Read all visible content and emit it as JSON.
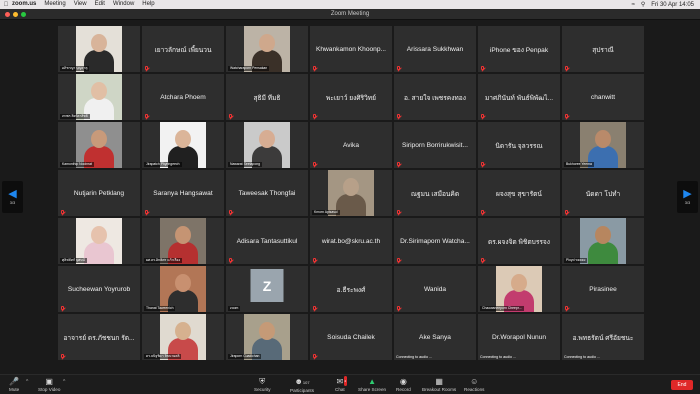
{
  "menubar": {
    "app": "zoom.us",
    "items": [
      "Meeting",
      "View",
      "Edit",
      "Window",
      "Help"
    ],
    "clock": "Fri 30 Apr 14:05"
  },
  "window": {
    "title": "Zoom Meeting"
  },
  "paging": {
    "left": "3/3",
    "right": "3/3"
  },
  "tiles": [
    {
      "label": "อภิชาญา บุญธาตุ",
      "video": true,
      "skin": "#d8b49a",
      "shirt": "#2a2a2a",
      "bg": "#e4e0d8"
    },
    {
      "name": "เยาวลักษณ์ เพี้ยนวน"
    },
    {
      "label": "Watcharaporn Pensakan",
      "video": true,
      "skin": "#cfa88c",
      "shirt": "#3a3028",
      "bg": "#bcb3a6"
    },
    {
      "name": "Khwankamon Khoonp..."
    },
    {
      "name": "Arissara Sukkhwan"
    },
    {
      "name": "iPhone ของ Penpak"
    },
    {
      "name": "สุปราณี"
    },
    {
      "label": "ภทพร สิงห์ลาสิทธิ์",
      "video": true,
      "skin": "#e1bfa5",
      "shirt": "#f0f0f0",
      "bg": "#cfd6c6"
    },
    {
      "name": "Atchara Phoem"
    },
    {
      "name": "สุธิมี ทีมธิ"
    },
    {
      "name": "พะเยาว์ ยงศิริวิทย์"
    },
    {
      "name": "อ. สายใจ เพชรคงทอง"
    },
    {
      "name": "มาศภินันท์ พันธ์พิพัฒไ..."
    },
    {
      "name": "chanwitt"
    },
    {
      "label": "Kamonthip Nooinrat",
      "video": true,
      "skin": "#c89a7a",
      "shirt": "#c03030",
      "bg": "#8f8f8f"
    },
    {
      "label": "Jirapatch Phyringeech",
      "video": true,
      "skin": "#dbb599",
      "shirt": "#202020",
      "bg": "#f2f2f2"
    },
    {
      "label": "Nawarat Seetapong",
      "video": true,
      "skin": "#d7ad93",
      "shirt": "#3c3b3b",
      "bg": "#cacaca"
    },
    {
      "name": "Avika"
    },
    {
      "name": "Siriporn Borrirukwisit..."
    },
    {
      "name": "นิดารัน จุลวรรณ"
    },
    {
      "label": "Bukhoree Yeema",
      "video": true,
      "skin": "#b98a6a",
      "shirt": "#3c6fb0",
      "bg": "#8a8070"
    },
    {
      "name": "Nutjarin Petklang"
    },
    {
      "name": "Saranya  Hangsawat"
    },
    {
      "name": "Taweesak Thongfai"
    },
    {
      "label": "Kmorn Apisasul",
      "video": true,
      "skin": "#b7a089",
      "shirt": "#6a5a4a",
      "bg": "#a49683"
    },
    {
      "name": "ณฐมน เสมือนคิด"
    },
    {
      "name": "ผจงสุข สุขารัตน์"
    },
    {
      "name": "นัดดา  โปทำ"
    },
    {
      "label": "ศุลิฟลัทก์ บุศนน์",
      "video": true,
      "skin": "#e6c2ad",
      "shirt": "#e9c6d1",
      "bg": "#eee8e2"
    },
    {
      "label": "ผศ.ดร.อิทธิศร แก้วเรือง",
      "video": true,
      "skin": "#c59473",
      "shirt": "#b53030",
      "bg": "#7e7468"
    },
    {
      "name": "Adisara Tantasuttikul"
    },
    {
      "name": "wirat.bo@skru.ac.th"
    },
    {
      "name": "Dr.Sirimaporn Watcha..."
    },
    {
      "name": "ดร.ผจงจิต พิชิตบรรจง"
    },
    {
      "label": "Ployd ขยลยง",
      "video": true,
      "skin": "#b7865f",
      "shirt": "#3e8a3e",
      "bg": "#8a9aa4"
    },
    {
      "name": "Sucheewan Yoyrurob"
    },
    {
      "label": "Thanat Taweenich",
      "video": true,
      "skin": "#c89070",
      "shirt": "#2e2e2e",
      "bg": "#b27656"
    },
    {
      "label": "zoom",
      "avatar": "Z"
    },
    {
      "name": "อ.ธีระพงศ์"
    },
    {
      "name": "Wanida"
    },
    {
      "label": "Chaowaneeporn Cheepr...",
      "video": true,
      "skin": "#d6ab8b",
      "shirt": "#c23c6e",
      "bg": "#dccab6"
    },
    {
      "name": "Pirasinee"
    },
    {
      "name": "อาจารย์ ดร.ภัชชนก รัต..."
    },
    {
      "label": "ดร.ธนิฐชิดา ลิขนาผลติ",
      "video": true,
      "skin": "#d6b18f",
      "shirt": "#c84a4a",
      "bg": "#e0dad0"
    },
    {
      "label": "Jiraporn Cuadichan",
      "video": true,
      "skin": "#c59a77",
      "shirt": "#586a78",
      "bg": "#a8a08c"
    },
    {
      "name": "Soisuda Chailek"
    },
    {
      "name": "Ake Sanya",
      "connect": "Connecting to audio ..."
    },
    {
      "name": "Dr.Worapol Nunun",
      "connect": "Connecting to audio ..."
    },
    {
      "name": "อ.พทธรัตน์  ศรีอัยชนะ",
      "connect": "Connecting to audio ..."
    }
  ],
  "toolbar": {
    "mute": "Mute",
    "stop_video": "Stop Video",
    "security": "Security",
    "participants": "Participants",
    "participants_count": "107",
    "chat": "Chat",
    "chat_badge": "2",
    "share_screen": "Share Screen",
    "record": "Record",
    "breakout": "Breakout Rooms",
    "reactions": "Reactions",
    "end": "End"
  }
}
